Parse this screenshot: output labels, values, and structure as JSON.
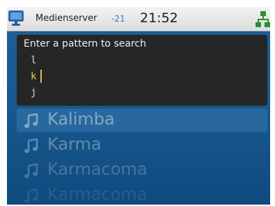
{
  "status_bar": {
    "app_icon": "monitor-icon",
    "title": "Medienserver",
    "signal": "-21",
    "time": "21:52",
    "network_icon": "network-icon"
  },
  "search": {
    "prompt": "Enter a pattern to search",
    "letter_prev": "l",
    "letter_current": "k",
    "letter_next": "j"
  },
  "songs": [
    {
      "icon": "music-note-icon",
      "title": "Kalimba"
    },
    {
      "icon": "music-note-icon",
      "title": "Karma"
    },
    {
      "icon": "music-note-icon",
      "title": "Karmacoma"
    },
    {
      "icon": "music-note-icon",
      "title": "Karmacoma"
    }
  ],
  "colors": {
    "background": "#195a91",
    "panel": "#262626",
    "highlight": "#e8d24a",
    "network": "#2d8f2d"
  }
}
